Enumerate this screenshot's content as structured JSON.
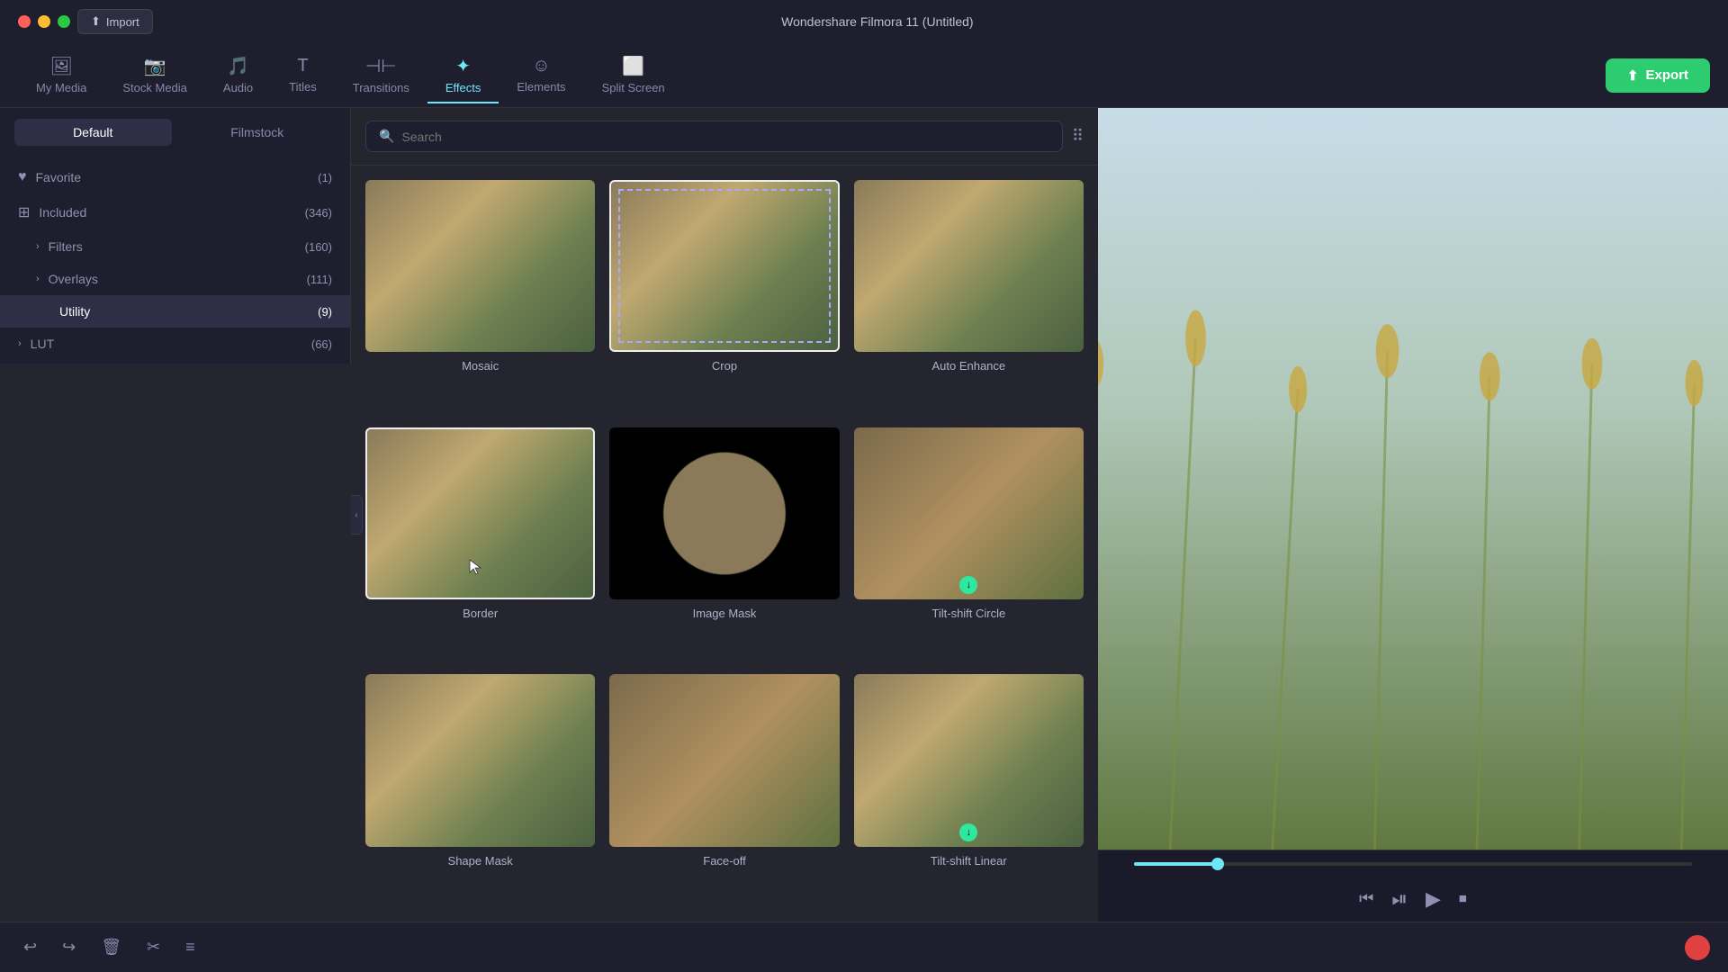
{
  "titleBar": {
    "title": "Wondershare Filmora 11 (Untitled)",
    "importLabel": "Import"
  },
  "nav": {
    "items": [
      {
        "id": "my-media",
        "label": "My Media",
        "icon": "🖼"
      },
      {
        "id": "stock-media",
        "label": "Stock Media",
        "icon": "📷"
      },
      {
        "id": "audio",
        "label": "Audio",
        "icon": "🎵"
      },
      {
        "id": "titles",
        "label": "Titles",
        "icon": "T"
      },
      {
        "id": "transitions",
        "label": "Transitions",
        "icon": "⊣⊢"
      },
      {
        "id": "effects",
        "label": "Effects",
        "icon": "✦",
        "active": true
      },
      {
        "id": "elements",
        "label": "Elements",
        "icon": "☺"
      },
      {
        "id": "split-screen",
        "label": "Split Screen",
        "icon": "⬜"
      }
    ],
    "exportLabel": "Export"
  },
  "sidebar": {
    "tabs": [
      {
        "id": "default",
        "label": "Default",
        "active": true
      },
      {
        "id": "filmstock",
        "label": "Filmstock"
      }
    ],
    "items": [
      {
        "id": "favorite",
        "label": "Favorite",
        "count": "(1)",
        "icon": "♥",
        "hasChevron": false,
        "indent": 0
      },
      {
        "id": "included",
        "label": "Included",
        "count": "(346)",
        "icon": "⊞",
        "hasChevron": true,
        "expanded": true,
        "indent": 0
      },
      {
        "id": "filters",
        "label": "Filters",
        "count": "(160)",
        "icon": "",
        "hasChevron": true,
        "indent": 1
      },
      {
        "id": "overlays",
        "label": "Overlays",
        "count": "(111)",
        "icon": "",
        "hasChevron": true,
        "indent": 1
      },
      {
        "id": "utility",
        "label": "Utility",
        "count": "(9)",
        "icon": "",
        "hasChevron": false,
        "indent": 1,
        "active": true
      },
      {
        "id": "lut",
        "label": "LUT",
        "count": "(66)",
        "icon": "",
        "hasChevron": true,
        "indent": 0
      }
    ]
  },
  "search": {
    "placeholder": "Search"
  },
  "effects": [
    {
      "id": "mosaic",
      "label": "Mosaic",
      "thumb": "mosaic",
      "hasBadge": false
    },
    {
      "id": "crop",
      "label": "Crop",
      "thumb": "crop",
      "hasBadge": false,
      "selected": true
    },
    {
      "id": "auto-enhance",
      "label": "Auto Enhance",
      "thumb": "auto-enhance",
      "hasBadge": false
    },
    {
      "id": "border",
      "label": "Border",
      "thumb": "border",
      "hasBadge": false,
      "selected": true
    },
    {
      "id": "image-mask",
      "label": "Image Mask",
      "thumb": "image-mask",
      "hasBadge": false
    },
    {
      "id": "tilt-shift-circle",
      "label": "Tilt-shift Circle",
      "thumb": "tilt-circle",
      "hasBadge": true
    },
    {
      "id": "shape-mask",
      "label": "Shape Mask",
      "thumb": "shape-mask",
      "hasBadge": false
    },
    {
      "id": "face-off",
      "label": "Face-off",
      "thumb": "faceoff",
      "hasBadge": false
    },
    {
      "id": "tilt-shift-linear",
      "label": "Tilt-shift Linear",
      "thumb": "tilt-linear",
      "hasBadge": true
    }
  ],
  "playControls": {
    "rewindLabel": "⏮",
    "playPauseLabel": "⏯",
    "playLabel": "▶",
    "stopLabel": "⏹"
  },
  "bottomToolbar": {
    "undoLabel": "↩",
    "redoLabel": "↪",
    "deleteLabel": "🗑",
    "cutLabel": "✂",
    "adjustLabel": "≡"
  }
}
